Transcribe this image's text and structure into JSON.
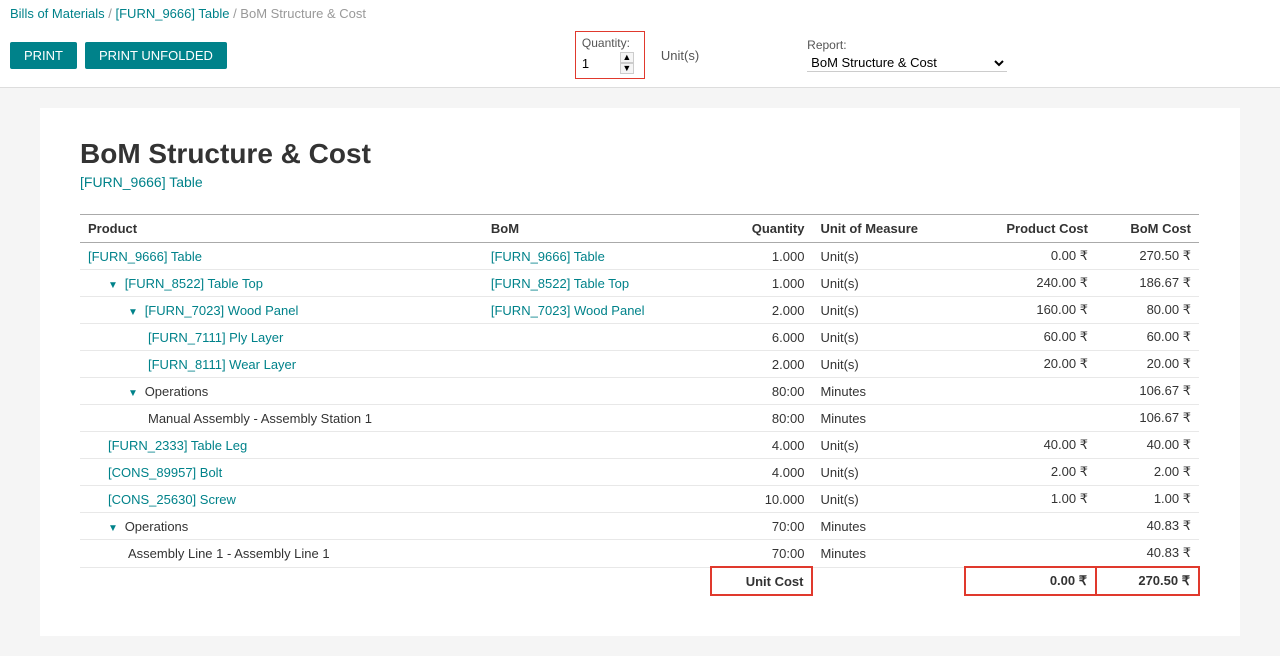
{
  "breadcrumb": {
    "part1": "Bills of Materials",
    "separator1": " / ",
    "part2": "[FURN_9666] Table",
    "separator2": " / ",
    "part3": "BoM Structure & Cost"
  },
  "toolbar": {
    "print_label": "PRINT",
    "print_unfolded_label": "PRINT UNFOLDED",
    "quantity_label": "Quantity:",
    "quantity_value": "1",
    "unit_label": "Unit(s)",
    "report_label": "Report:",
    "report_value": "BoM Structure & Cost"
  },
  "report": {
    "title": "BoM Structure & Cost",
    "subtitle": "[FURN_9666] Table"
  },
  "table": {
    "headers": [
      "Product",
      "BoM",
      "Quantity",
      "Unit of Measure",
      "Product Cost",
      "BoM Cost"
    ],
    "rows": [
      {
        "indent": 0,
        "product": "[FURN_9666] Table",
        "product_link": true,
        "bom": "[FURN_9666] Table",
        "bom_link": true,
        "quantity": "1.000",
        "uom": "Unit(s)",
        "product_cost": "0.00 ₹",
        "bom_cost": "270.50 ₹",
        "triangle": false,
        "ops": false
      },
      {
        "indent": 1,
        "product": "[FURN_8522] Table Top",
        "product_link": true,
        "bom": "[FURN_8522] Table Top",
        "bom_link": true,
        "quantity": "1.000",
        "uom": "Unit(s)",
        "product_cost": "240.00 ₹",
        "bom_cost": "186.67 ₹",
        "triangle": true,
        "ops": false
      },
      {
        "indent": 2,
        "product": "[FURN_7023] Wood Panel",
        "product_link": true,
        "bom": "[FURN_7023] Wood Panel",
        "bom_link": true,
        "quantity": "2.000",
        "uom": "Unit(s)",
        "product_cost": "160.00 ₹",
        "bom_cost": "80.00 ₹",
        "triangle": true,
        "ops": false
      },
      {
        "indent": 3,
        "product": "[FURN_7111] Ply Layer",
        "product_link": true,
        "bom": "",
        "bom_link": false,
        "quantity": "6.000",
        "uom": "Unit(s)",
        "product_cost": "60.00 ₹",
        "bom_cost": "60.00 ₹",
        "triangle": false,
        "ops": false
      },
      {
        "indent": 3,
        "product": "[FURN_8111] Wear Layer",
        "product_link": true,
        "bom": "",
        "bom_link": false,
        "quantity": "2.000",
        "uom": "Unit(s)",
        "product_cost": "20.00 ₹",
        "bom_cost": "20.00 ₹",
        "triangle": false,
        "ops": false
      },
      {
        "indent": 2,
        "product": "Operations",
        "product_link": false,
        "bom": "",
        "bom_link": false,
        "quantity": "80:00",
        "uom": "Minutes",
        "product_cost": "",
        "bom_cost": "106.67 ₹",
        "triangle": true,
        "ops": true
      },
      {
        "indent": 3,
        "product": "Manual Assembly - Assembly Station 1",
        "product_link": false,
        "bom": "",
        "bom_link": false,
        "quantity": "80:00",
        "uom": "Minutes",
        "product_cost": "",
        "bom_cost": "106.67 ₹",
        "triangle": false,
        "ops": false
      },
      {
        "indent": 1,
        "product": "[FURN_2333] Table Leg",
        "product_link": true,
        "bom": "",
        "bom_link": false,
        "quantity": "4.000",
        "uom": "Unit(s)",
        "product_cost": "40.00 ₹",
        "bom_cost": "40.00 ₹",
        "triangle": false,
        "ops": false
      },
      {
        "indent": 1,
        "product": "[CONS_89957] Bolt",
        "product_link": true,
        "bom": "",
        "bom_link": false,
        "quantity": "4.000",
        "uom": "Unit(s)",
        "product_cost": "2.00 ₹",
        "bom_cost": "2.00 ₹",
        "triangle": false,
        "ops": false
      },
      {
        "indent": 1,
        "product": "[CONS_25630] Screw",
        "product_link": true,
        "bom": "",
        "bom_link": false,
        "quantity": "10.000",
        "uom": "Unit(s)",
        "product_cost": "1.00 ₹",
        "bom_cost": "1.00 ₹",
        "triangle": false,
        "ops": false
      },
      {
        "indent": 1,
        "product": "Operations",
        "product_link": false,
        "bom": "",
        "bom_link": false,
        "quantity": "70:00",
        "uom": "Minutes",
        "product_cost": "",
        "bom_cost": "40.83 ₹",
        "triangle": true,
        "ops": true
      },
      {
        "indent": 2,
        "product": "Assembly Line 1 - Assembly Line 1",
        "product_link": false,
        "bom": "",
        "bom_link": false,
        "quantity": "70:00",
        "uom": "Minutes",
        "product_cost": "",
        "bom_cost": "40.83 ₹",
        "triangle": false,
        "ops": false
      }
    ],
    "unit_cost_label": "Unit Cost",
    "unit_cost_product": "0.00 ₹",
    "unit_cost_bom": "270.50 ₹"
  }
}
